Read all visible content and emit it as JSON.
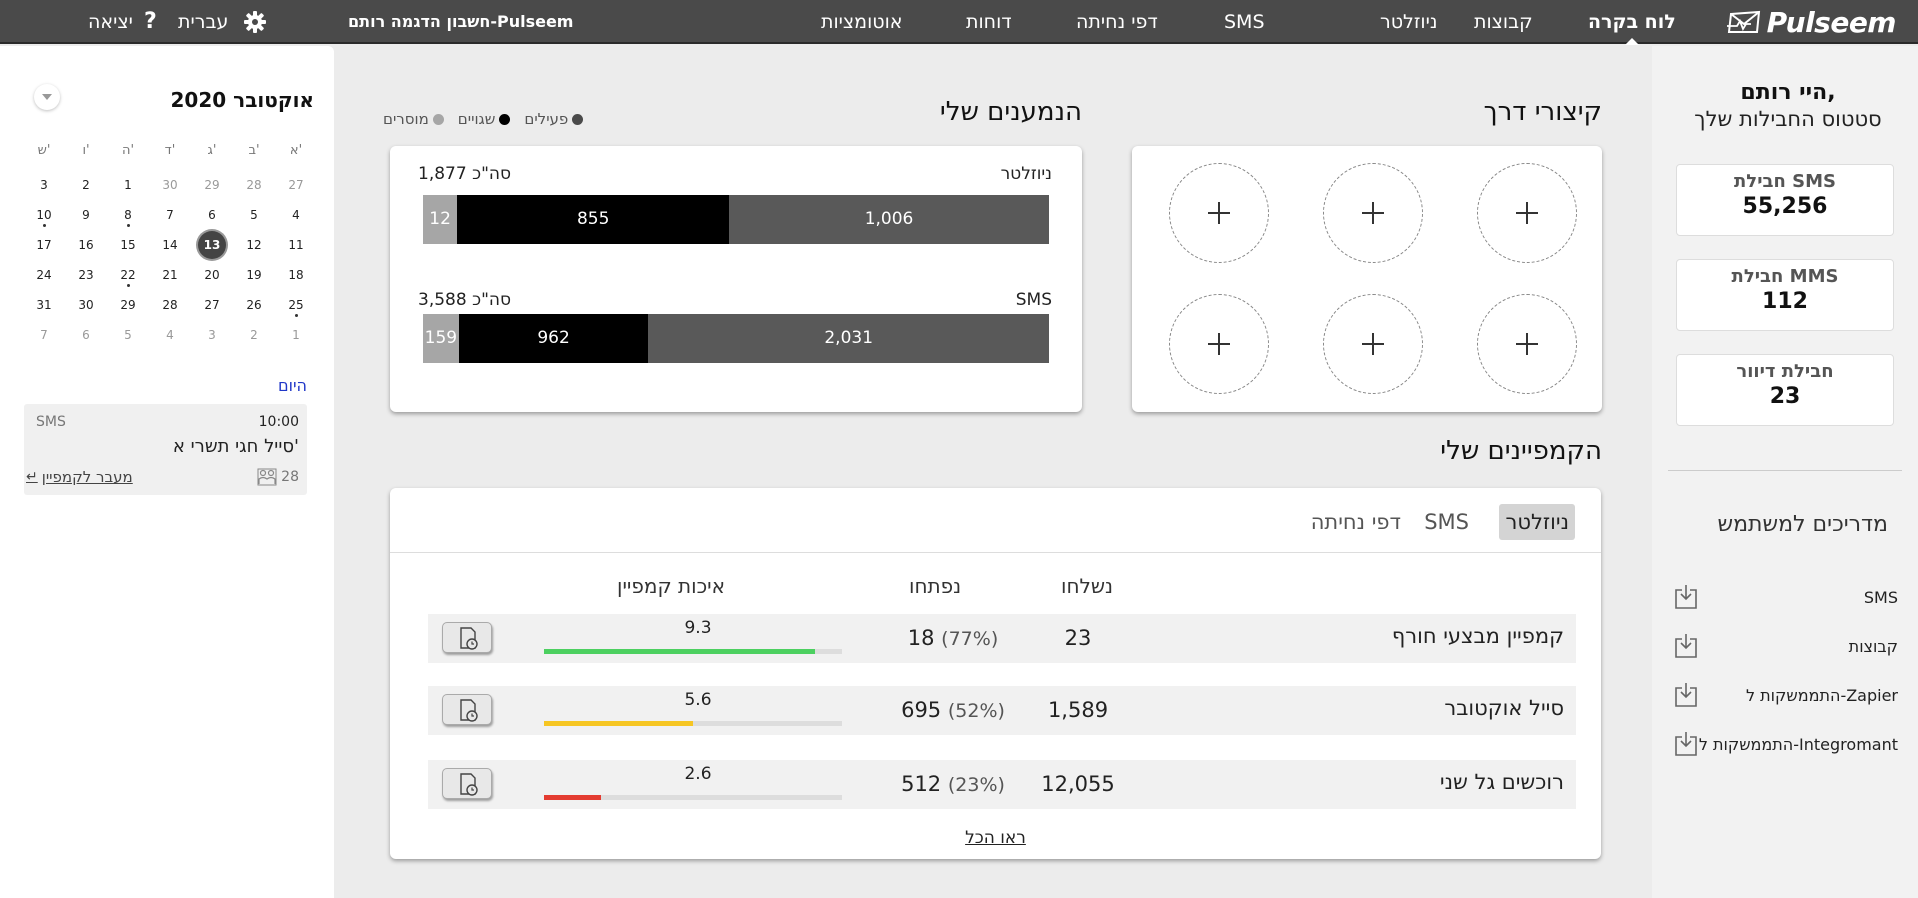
{
  "topbar": {
    "logo_text": "Pulseem",
    "nav": [
      "לוח בקרה",
      "קבוצות",
      "ניוזלטר",
      "SMS",
      "דפי נחיתה",
      "דוחות",
      "אוטומציות"
    ],
    "account": "חשבון הדגמה רותם-Pulseem",
    "language": "עברית",
    "help_icon": "help-icon",
    "settings_icon": "gear-icon",
    "logout": "יציאה"
  },
  "sidebar": {
    "greeting": "היי רותם,",
    "subtitle": "סטטוס החבילות שלך",
    "packages": [
      {
        "label": "חבילת SMS",
        "value": "55,256"
      },
      {
        "label": "חבילת MMS",
        "value": "112"
      },
      {
        "label": "חבילת דיוור",
        "value": "23"
      }
    ],
    "guides_title": "מדריכים למשתמש",
    "guides": [
      "SMS",
      "קבוצות",
      "התממשקות ל-Zapier",
      "התממשקות ל-Integromant"
    ],
    "guide_icon": "download-icon"
  },
  "shortcuts": {
    "title": "קיצורי דרך",
    "slots": [
      "+",
      "+",
      "+",
      "+",
      "+",
      "+"
    ]
  },
  "recipients": {
    "title": "הנמענים שלי",
    "legend": [
      {
        "label": "פעילים",
        "color": "#4a4a4a"
      },
      {
        "label": "שגויים",
        "color": "#000000"
      },
      {
        "label": "מוסרים",
        "color": "#a6a6a6"
      }
    ],
    "rows": [
      {
        "label": "ניוזלטר",
        "total": "סה\"כ 1,877",
        "values": [
          1006,
          855,
          12
        ],
        "value_labels": [
          "1,006",
          "855",
          "12"
        ]
      },
      {
        "label": "SMS",
        "total": "סה\"כ 3,588",
        "values": [
          2031,
          962,
          159
        ],
        "value_labels": [
          "2,031",
          "962",
          "159"
        ]
      }
    ]
  },
  "campaigns": {
    "title": "הקמפיינים שלי",
    "tabs": [
      "ניוזלטר",
      "SMS",
      "דפי נחיתה"
    ],
    "active_tab": "ניוזלטר",
    "columns": {
      "sent": "נשלחו",
      "opened": "נפתחו",
      "quality": "איכות קמפיין"
    },
    "rows": [
      {
        "name": "קמפיין מבצעי חורף",
        "sent": "23",
        "opened": "18",
        "open_pct": "(77%)",
        "quality": "9.3",
        "quality_fraction": 0.91,
        "quality_color": "#4cd060"
      },
      {
        "name": "סייל אוקטובר",
        "sent": "1,589",
        "opened": "695",
        "open_pct": "(52%)",
        "quality": "5.6",
        "quality_fraction": 0.5,
        "quality_color": "#f6c623"
      },
      {
        "name": "רוכשים גל שני",
        "sent": "12,055",
        "opened": "512",
        "open_pct": "(23%)",
        "quality": "2.6",
        "quality_fraction": 0.19,
        "quality_color": "#e43c31"
      }
    ],
    "report_icon": "report-clock-icon",
    "see_all": "ראו הכל"
  },
  "calendar": {
    "title": "אוקטובר 2020",
    "weekdays": [
      "א'",
      "ב'",
      "ג'",
      "ד'",
      "ה'",
      "ו'",
      "ש'"
    ],
    "weeks": [
      [
        {
          "d": "27",
          "m": true
        },
        {
          "d": "28",
          "m": true
        },
        {
          "d": "29",
          "m": true
        },
        {
          "d": "30",
          "m": true
        },
        {
          "d": "1"
        },
        {
          "d": "2"
        },
        {
          "d": "3"
        }
      ],
      [
        {
          "d": "4"
        },
        {
          "d": "5"
        },
        {
          "d": "6"
        },
        {
          "d": "7"
        },
        {
          "d": "8",
          "e": true
        },
        {
          "d": "9"
        },
        {
          "d": "10",
          "e": true
        }
      ],
      [
        {
          "d": "11"
        },
        {
          "d": "12"
        },
        {
          "d": "13",
          "t": true
        },
        {
          "d": "14"
        },
        {
          "d": "15"
        },
        {
          "d": "16"
        },
        {
          "d": "17"
        }
      ],
      [
        {
          "d": "18"
        },
        {
          "d": "19"
        },
        {
          "d": "20"
        },
        {
          "d": "21"
        },
        {
          "d": "22",
          "e": true
        },
        {
          "d": "23"
        },
        {
          "d": "24"
        }
      ],
      [
        {
          "d": "25",
          "e": true
        },
        {
          "d": "26"
        },
        {
          "d": "27"
        },
        {
          "d": "28"
        },
        {
          "d": "29"
        },
        {
          "d": "30"
        },
        {
          "d": "31"
        }
      ],
      [
        {
          "d": "1",
          "m": true
        },
        {
          "d": "2",
          "m": true
        },
        {
          "d": "3",
          "m": true
        },
        {
          "d": "4",
          "m": true
        },
        {
          "d": "5",
          "m": true
        },
        {
          "d": "6",
          "m": true
        },
        {
          "d": "7",
          "m": true
        }
      ]
    ],
    "today_label": "היום",
    "event": {
      "time": "10:00",
      "channel": "SMS",
      "title": "סייל חגי תשרי א'",
      "count": "28",
      "link": "מעבר לקמפיין"
    }
  }
}
